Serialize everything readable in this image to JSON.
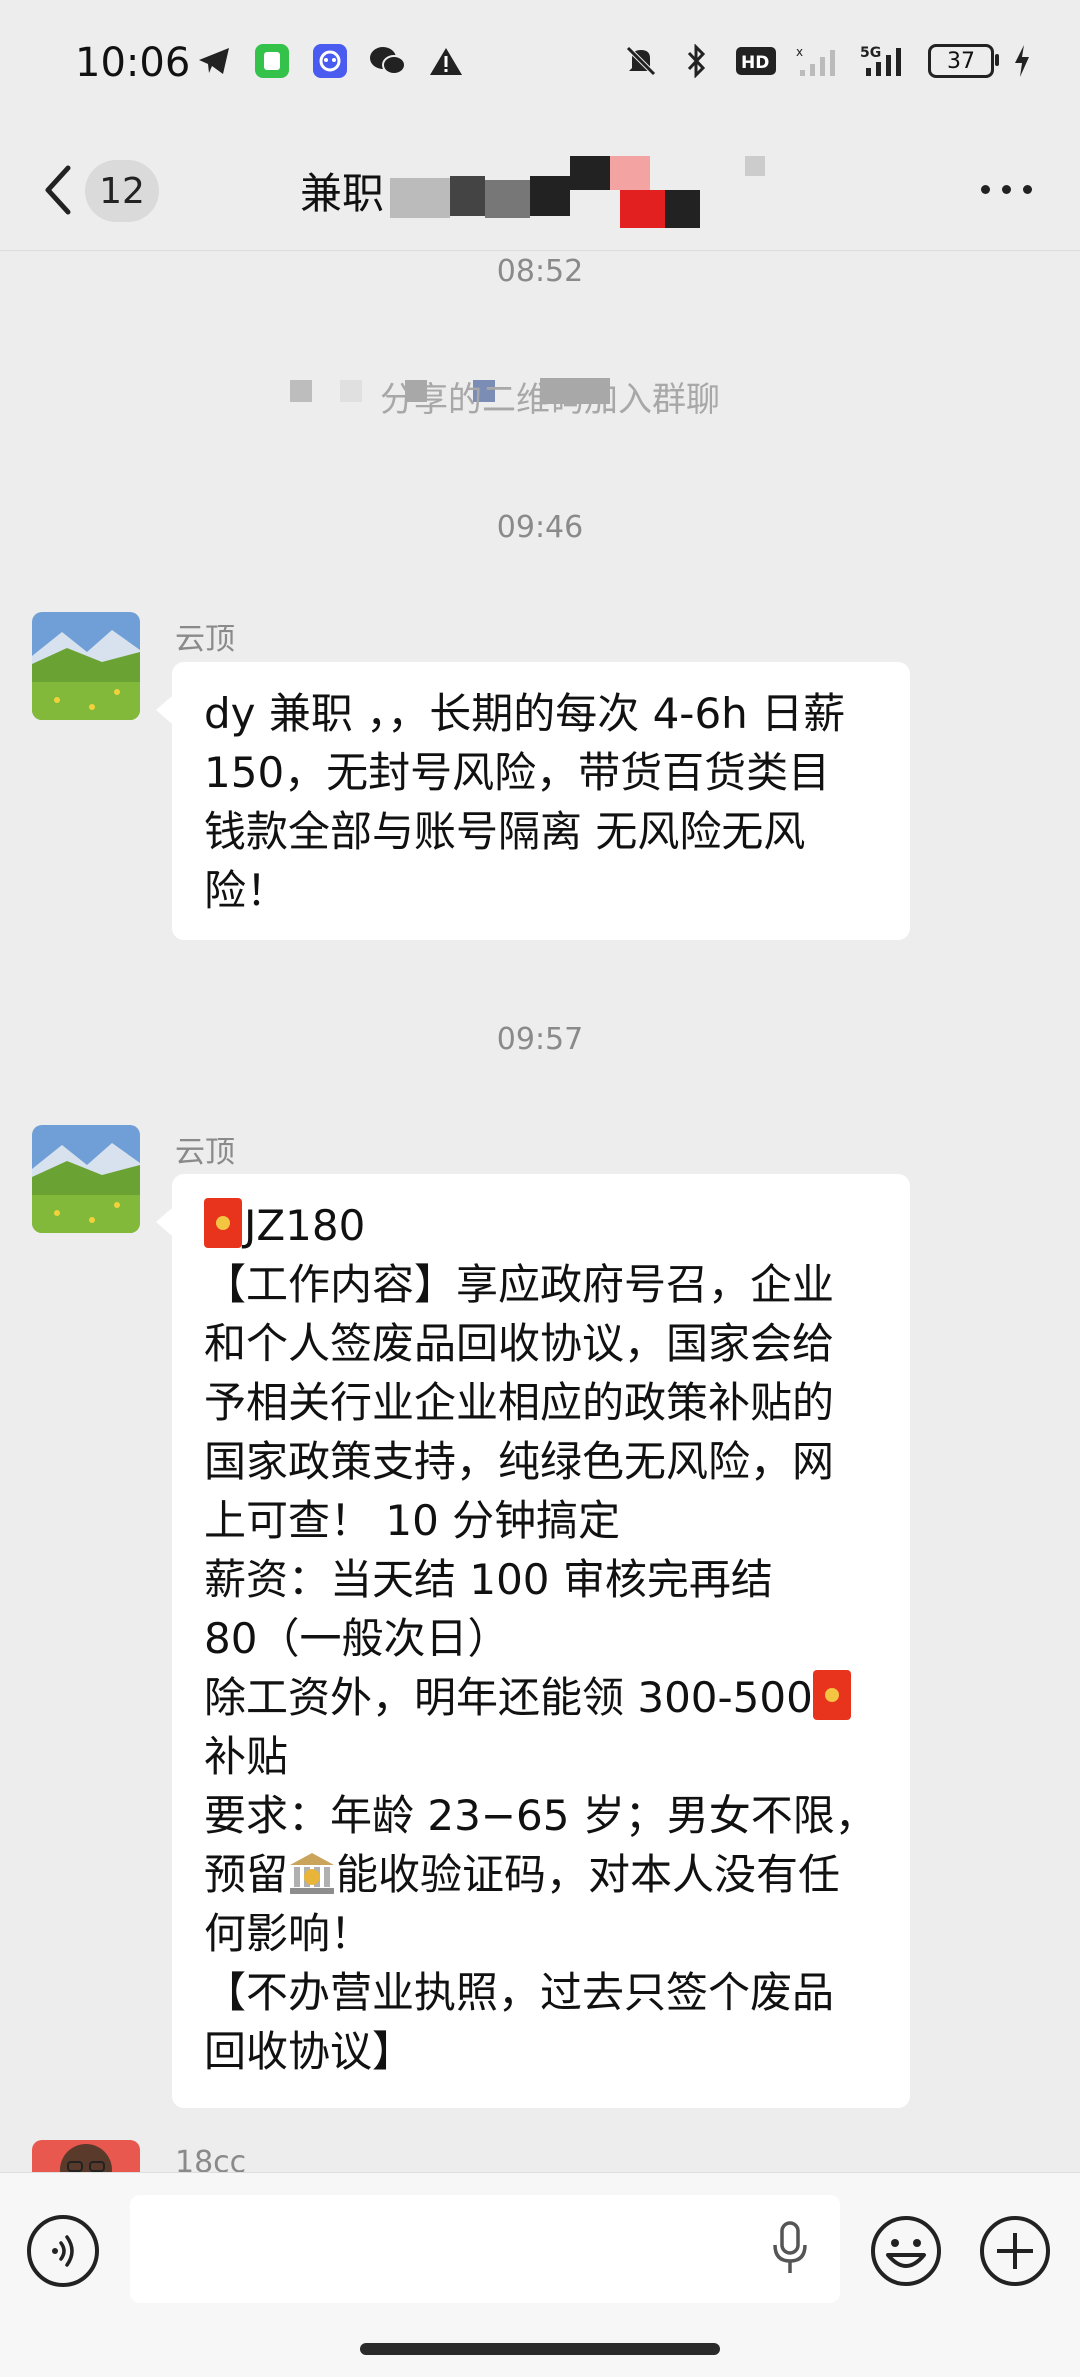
{
  "status_bar": {
    "time": "10:06",
    "battery": "37",
    "network": "5G",
    "hd": "HD2",
    "left_icons": [
      "telegram-icon",
      "app-green-icon",
      "app-blue-icon",
      "wechat-icon",
      "warning-icon"
    ],
    "right_icons": [
      "mute-icon",
      "bluetooth-icon",
      "hd-icon",
      "signal-icon",
      "5g-signal-icon",
      "battery-icon",
      "charging-icon"
    ]
  },
  "nav": {
    "unread_count": "12",
    "title": "兼职"
  },
  "messages": [
    {
      "type": "time",
      "text": "08:52"
    },
    {
      "type": "system",
      "text": "分享的二维码加入群聊"
    },
    {
      "type": "time",
      "text": "09:46"
    },
    {
      "type": "chat",
      "sender": "云顶",
      "lines": [
        "dy 兼职 ，，长期的每次 4-6h 日薪",
        "150，无封号风险，带货百货类目",
        "钱款全部与账号隔离 无风险无风",
        "险！"
      ]
    },
    {
      "type": "time",
      "text": "09:57"
    },
    {
      "type": "chat",
      "sender": "云顶",
      "title": "JZ180",
      "lines": [
        "【工作内容】享应政府号召，企业",
        "和个人签废品回收协议，国家会给",
        "予相关行业企业相应的政策补贴的",
        "国家政策支持，纯绿色无风险，网",
        "上可查！ 10 分钟搞定",
        "薪资：当天结 100 审核完再结",
        "80（一般次日）",
        "除工资外，明年还能领 300-500",
        "补贴",
        "要求：年龄 23−65 岁；男女不限，",
        "能收验证码，对本人没有任",
        "何影响！",
        "【不办营业执照，过去只签个废品",
        "回收协议】"
      ],
      "line11_prefix": "预留"
    },
    {
      "type": "chat",
      "sender": "18cc"
    }
  ],
  "input_bar": {
    "placeholder": ""
  },
  "colors": {
    "background": "#ededed",
    "bubble": "#ffffff",
    "redpacket": "#e8341c"
  }
}
